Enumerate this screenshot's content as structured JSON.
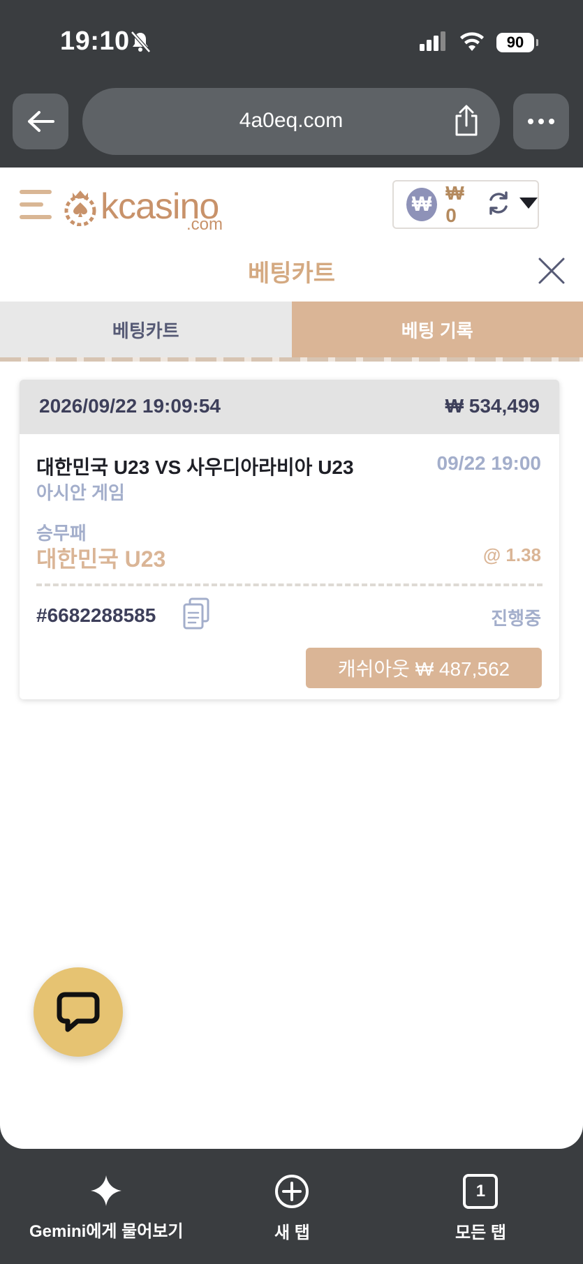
{
  "status_bar": {
    "time": "19:10",
    "battery": "90"
  },
  "browser": {
    "url": "4a0eq.com"
  },
  "header": {
    "logo_text": "kcasino",
    "logo_suffix": ".com",
    "currency_symbol": "₩",
    "balance": "₩ 0"
  },
  "cart": {
    "title": "베팅카트",
    "tabs": [
      {
        "label": "베팅카트",
        "active": false
      },
      {
        "label": "베팅 기록",
        "active": true
      }
    ]
  },
  "bet": {
    "datetime": "2026/09/22 19:09:54",
    "amount": "₩ 534,499",
    "match": "대한민국 U23 VS 사우디아라비아 U23",
    "match_time": "09/22 19:00",
    "league": "아시안 게임",
    "market": "승무패",
    "pick": "대한민국 U23",
    "odds": "@ 1.38",
    "ticket_id": "#6682288585",
    "status": "진행중",
    "cashout_label": "캐쉬아웃 ₩ 487,562"
  },
  "toolbar": {
    "items": [
      {
        "label": "Gemini에게 물어보기",
        "icon": "sparkle-icon"
      },
      {
        "label": "새 탭",
        "icon": "plus-circle-icon"
      },
      {
        "label": "모든 탭",
        "icon": "tabs-icon",
        "count": "1"
      }
    ]
  },
  "colors": {
    "accent": "#dab596",
    "brand": "#c8926a",
    "muted": "#a3aecb",
    "chat": "#e6c372"
  }
}
